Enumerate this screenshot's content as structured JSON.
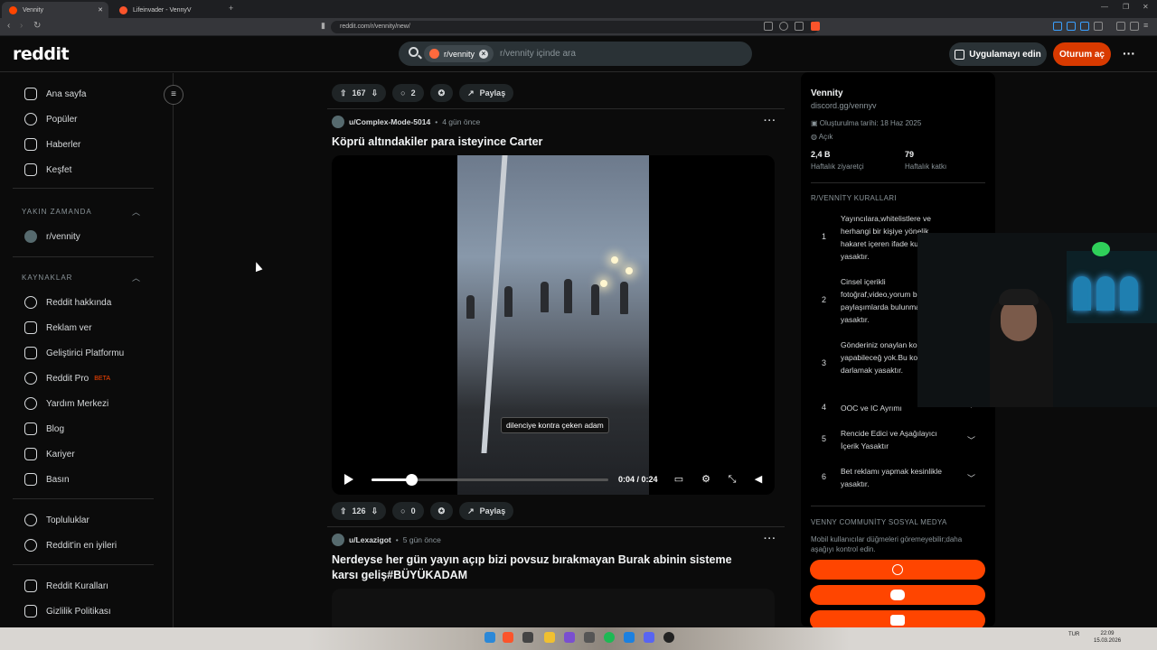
{
  "browser": {
    "tabs": [
      {
        "title": "Vennity",
        "active": true
      },
      {
        "title": "Lifeinvader - VennyV",
        "active": false
      }
    ],
    "url": "reddit.com/r/vennity/new/"
  },
  "header": {
    "logo": "reddit",
    "search_chip": "r/vennity",
    "search_placeholder": "r/vennity içinde ara",
    "app_button": "Uygulamayı edin",
    "login_button": "Oturum aç"
  },
  "sidebar": {
    "main_items": [
      {
        "label": "Ana sayfa",
        "icon": "home-icon"
      },
      {
        "label": "Popüler",
        "icon": "popular-icon"
      },
      {
        "label": "Haberler",
        "icon": "news-icon"
      },
      {
        "label": "Keşfet",
        "icon": "explore-icon"
      }
    ],
    "recent_heading": "YAKIN ZAMANDA",
    "recent_items": [
      {
        "label": "r/vennity"
      }
    ],
    "resources_heading": "KAYNAKLAR",
    "resource_items": [
      {
        "label": "Reddit hakkında",
        "icon": "reddit-icon"
      },
      {
        "label": "Reklam ver",
        "icon": "megaphone-icon"
      },
      {
        "label": "Geliştirici Platformu",
        "icon": "developer-icon"
      },
      {
        "label": "Reddit Pro",
        "icon": "pro-icon",
        "badge": "BETA"
      },
      {
        "label": "Yardım Merkezi",
        "icon": "help-icon"
      },
      {
        "label": "Blog",
        "icon": "blog-icon"
      },
      {
        "label": "Kariyer",
        "icon": "career-icon"
      },
      {
        "label": "Basın",
        "icon": "press-icon"
      }
    ],
    "community_items": [
      {
        "label": "Topluluklar",
        "icon": "communities-icon"
      },
      {
        "label": "Reddit'in en iyileri",
        "icon": "best-icon"
      }
    ],
    "policy_items": [
      {
        "label": "Reddit Kuralları",
        "icon": "rules-icon"
      },
      {
        "label": "Gizlilik Politikası",
        "icon": "privacy-icon"
      }
    ]
  },
  "feed": {
    "top_actions": {
      "votes": "167",
      "comments": "2",
      "share": "Paylaş"
    },
    "posts": [
      {
        "user": "u/Complex-Mode-5014",
        "time": "4 gün önce",
        "title": "Köprü altındakiler para isteyince Carter",
        "video": {
          "subtitle": "dilenciye kontra çeken adam",
          "time": "0:04 / 0:24",
          "progress": 0.1667
        },
        "votes": "126",
        "comments": "0",
        "share": "Paylaş"
      },
      {
        "user": "u/Lexazigot",
        "time": "5 gün önce",
        "title": "Nerdeyse her gün yayın açıp bizi povsuz bırakmayan Burak abinin sisteme karsı geliş#BÜYÜKADAM"
      }
    ]
  },
  "community": {
    "name": "Vennity",
    "link": "discord.gg/vennyv",
    "created": "Oluşturulma tarihi: 18 Haz 2025",
    "visibility": "Açık",
    "stats": [
      {
        "value": "2,4 B",
        "label": "Haftalık ziyaretçi"
      },
      {
        "value": "79",
        "label": "Haftalık katkı"
      }
    ],
    "rules_heading": "R/VENNİTY KURALLARI",
    "rules": [
      {
        "num": "1",
        "text": "Yayıncılara,whitelistlere ve herhangi bir kişiye yönelik hakaret içeren ifade kullanmak yasaktır."
      },
      {
        "num": "2",
        "text": "Cinsel içerikli fotoğraf,video,yorum benzeri paylaşımlarda bulunmak yasaktır."
      },
      {
        "num": "3",
        "text": "Gönderiniz onaylan konuda yapabileceğ yok.Bu konuda mod darlamak yasaktır."
      },
      {
        "num": "4",
        "text": "OOC ve IC Ayrımı"
      },
      {
        "num": "5",
        "text": "Rencide Edici ve Aşağılayıcı İçerik Yasaktır"
      },
      {
        "num": "6",
        "text": "Bet reklamı yapmak kesinlikle yasaktır."
      }
    ],
    "social_heading": "VENNY COMMUNİTY SOSYAL MEDYA",
    "social_note": "Mobil kullanıcılar düğmeleri göremeyebilir;daha aşağıyı kontrol edin.",
    "social_buttons": [
      {
        "icon": "globe-icon"
      },
      {
        "icon": "discord-icon"
      },
      {
        "icon": "youtube-icon"
      }
    ]
  },
  "taskbar": {
    "lang": "TUR",
    "time": "22:09",
    "date": "15.03.2026"
  },
  "colors": {
    "accent": "#ff4500",
    "login": "#d93a00",
    "background": "#0b0b0b"
  }
}
